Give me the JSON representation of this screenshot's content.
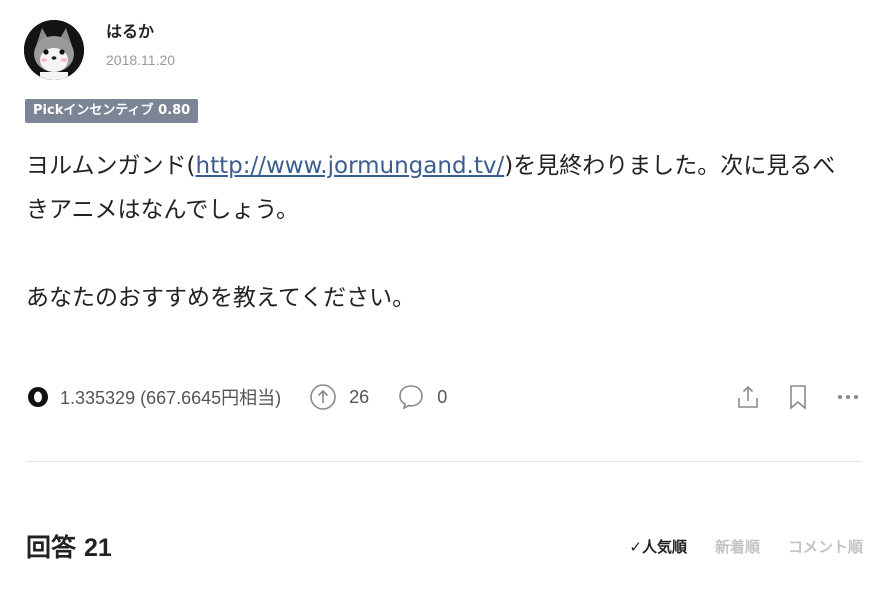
{
  "author": {
    "name": "はるか",
    "date": "2018.11.20"
  },
  "badge": {
    "label": "Pickインセンティブ 0.80"
  },
  "question": {
    "before_link": "ヨルムンガンド(",
    "link_text": "http://www.jormungand.tv/",
    "after_link": ")を見終わりました。次に見るべきアニメはなんでしょう。",
    "paragraph2": "あなたのおすすめを教えてください。"
  },
  "stats": {
    "coin_text": "1.335329 (667.6645円相当)",
    "upvotes": "26",
    "comments": "0"
  },
  "answers": {
    "title": "回答",
    "count": "21"
  },
  "sort": {
    "tabs": [
      {
        "label": "✓人気順",
        "active": true
      },
      {
        "label": "新着順",
        "active": false
      },
      {
        "label": "コメント順",
        "active": false
      }
    ]
  },
  "icons": {
    "coin": "coin-icon",
    "upvote": "upvote-icon",
    "comment": "comment-icon",
    "share": "share-icon",
    "bookmark": "bookmark-icon",
    "more": "more-icon"
  }
}
